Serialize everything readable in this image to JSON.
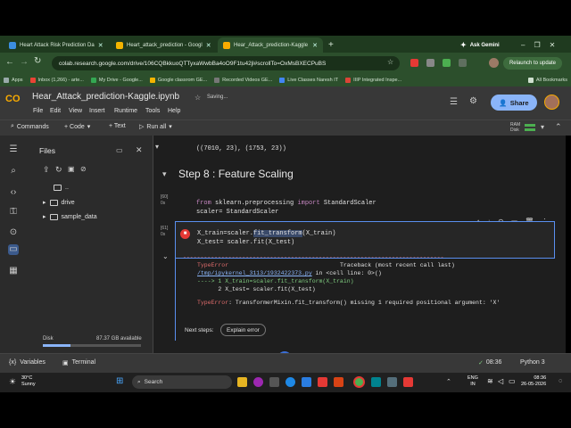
{
  "browser": {
    "tabs": [
      {
        "label": "Heart Attack Risk Prediction Da",
        "color": "#3c8ee0"
      },
      {
        "label": "Heart_attack_prediction - Googl",
        "color": "#f4b400"
      },
      {
        "label": "Hear_Attack_prediction-Kaggle",
        "color": "#f9ab00"
      }
    ],
    "new_tab": "+",
    "ask_gemini": "Ask Gemini",
    "url": "colab.research.google.com/drive/106CQBkkuoQTTyxaWwbBa4oO9F1tu42jl#scrollTo=OxMsBXECPuBS",
    "relaunch": "Relaunch to update",
    "bookmarks": [
      {
        "label": "Apps",
        "color": "#9aa"
      },
      {
        "label": "Inbox (1,266) - arte...",
        "color": "#ea4335"
      },
      {
        "label": "My Drive - Google...",
        "color": "#34a853"
      },
      {
        "label": "Google classrom GE...",
        "color": "#f4b400"
      },
      {
        "label": "Recorded Videos GE...",
        "color": "#777"
      },
      {
        "label": "Live Classes Naresh IT",
        "color": "#4285f4"
      },
      {
        "label": "IIIP Integrated Inspe...",
        "color": "#db4437"
      }
    ],
    "all_bookmarks": "All Bookmarks"
  },
  "colab": {
    "logo": "CO",
    "title": "Hear_Attack_prediction-Kaggle.ipynb",
    "saving": "Saving...",
    "menus": [
      "File",
      "Edit",
      "View",
      "Insert",
      "Runtime",
      "Tools",
      "Help"
    ],
    "share": "Share",
    "toolbar": {
      "commands": "Commands",
      "code": "+ Code",
      "text": "+ Text",
      "run_all": "Run all"
    },
    "ram": "RAM",
    "disk": "Disk"
  },
  "files": {
    "title": "Files",
    "items": [
      "..",
      "drive",
      "sample_data"
    ],
    "disk_label": "Disk",
    "disk_available": "87.37 GB available"
  },
  "notebook": {
    "prev_output": "((7010, 23), (1753, 23))",
    "section": "Step 8 : Feature Scaling",
    "cell1": {
      "exec": "[60]",
      "time": "0s",
      "line1_kw1": "from",
      "line1_mod": "sklearn.preprocessing",
      "line1_kw2": "import",
      "line1_name": "StandardScaler",
      "line2": "scaler= StandardScaler"
    },
    "cell2": {
      "exec": "[61]",
      "time": "0s",
      "line1_a": "X_train=scaler.",
      "line1_b": "fit_transform",
      "line1_c": "(X_train)",
      "line2": "X_test= scaler.fit(X_test)"
    },
    "output": {
      "dashes": "---------------------------------------------------------------------------",
      "error_type": "TypeError",
      "traceback": "Traceback (most recent call last)",
      "file_link": "/tmp/ipykernel_3113/1932422373.py",
      "file_rest": " in <cell line: 0>()",
      "line1": "----> 1 X_train=scaler.fit_transform(X_train)",
      "line2": "      2 X_test= scaler.fit(X_test)",
      "msg_type": "TypeError",
      "msg": ": TransformerMixin.fit_transform() missing 1 required positional argument: 'X'"
    },
    "next_steps": "Next steps:",
    "explain_error": "Explain error"
  },
  "status": {
    "variables": "Variables",
    "terminal": "Terminal",
    "time": "08:36",
    "runtime": "Python 3"
  },
  "taskbar": {
    "weather_temp": "30°C",
    "weather_desc": "Sunny",
    "search": "Search",
    "lang1": "ENG",
    "lang2": "IN",
    "clock_time": "08:36",
    "clock_date": "26-05-2026"
  }
}
